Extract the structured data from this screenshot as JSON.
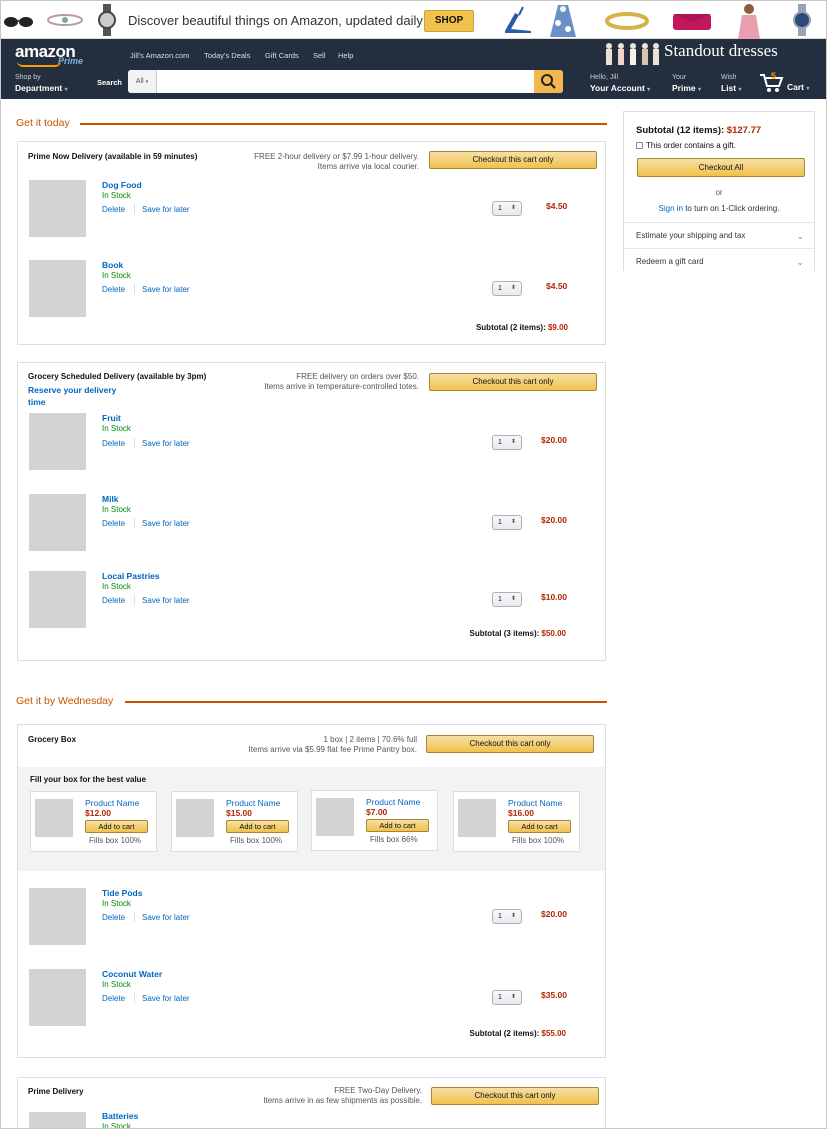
{
  "banner": {
    "text": "Discover beautiful things on Amazon, updated daily",
    "shop": "SHOP"
  },
  "nav": {
    "logo": "amazon",
    "prime": "Prime",
    "top_links": [
      "Jill's Amazon.com",
      "Today's Deals",
      "Gift Cards",
      "Sell",
      "Help"
    ],
    "promo": "Standout dresses",
    "shop_by_small": "Shop by",
    "shop_by_big": "Department",
    "search_label": "Search",
    "search_scope": "All",
    "hello": "Hello, Jill",
    "your_account": "Your Account",
    "your": "Your",
    "prime_link": "Prime",
    "wish": "Wish",
    "list": "List",
    "cart_count": "5",
    "cart": "Cart"
  },
  "section1": {
    "title": "Get it today"
  },
  "section2": {
    "title": "Get it by Wednesday"
  },
  "common": {
    "delete": "Delete",
    "save_for_later": "Save for later",
    "in_stock": "In Stock",
    "checkout_only": "Checkout this cart only",
    "add_to_cart": "Add to cart"
  },
  "prime_now": {
    "title": "Prime Now Delivery (available in 59 minutes)",
    "note1": "FREE 2-hour delivery or $7.99 1-hour delivery.",
    "note2": "Items arrive via local courier.",
    "items": [
      {
        "name": "Dog Food",
        "qty": "1",
        "price": "$4.50"
      },
      {
        "name": "Book",
        "qty": "1",
        "price": "$4.50"
      }
    ],
    "subtotal_label": "Subtotal (2 items):",
    "subtotal": "$9.00"
  },
  "grocery_scheduled": {
    "title": "Grocery Scheduled Delivery (available by 3pm)",
    "reserve1": "Reserve your delivery",
    "reserve2": "time",
    "note1": "FREE delivery on orders over $50.",
    "note2": "Items arrive in temperature-controlled totes.",
    "items": [
      {
        "name": "Fruit",
        "qty": "1",
        "price": "$20.00"
      },
      {
        "name": "Milk",
        "qty": "1",
        "price": "$20.00"
      },
      {
        "name": "Local Pastries",
        "qty": "1",
        "price": "$10.00"
      }
    ],
    "subtotal_label": "Subtotal (3 items):",
    "subtotal": "$50.00"
  },
  "grocery_box": {
    "title": "Grocery Box",
    "note1": "1 box | 2 items | 70.6% full",
    "note2": "Items arrive via $5.99 flat fee Prime Pantry box.",
    "fill_title": "Fill your box for the best value",
    "suggestions": [
      {
        "name": "Product Name",
        "price": "$12.00",
        "fills": "Fills box 100%"
      },
      {
        "name": "Product Name",
        "price": "$15.00",
        "fills": "Fills box 100%"
      },
      {
        "name": "Product Name",
        "price": "$7.00",
        "fills": "Fills box 66%"
      },
      {
        "name": "Product Name",
        "price": "$16.00",
        "fills": "Fills box 100%"
      }
    ],
    "items": [
      {
        "name": "Tide Pods",
        "qty": "1",
        "price": "$20.00"
      },
      {
        "name": "Coconut Water",
        "qty": "1",
        "price": "$35.00"
      }
    ],
    "subtotal_label": "Subtotal (2 items):",
    "subtotal": "$55.00"
  },
  "prime_delivery": {
    "title": "Prime Delivery",
    "note1": "FREE Two-Day Delivery.",
    "note2": "Items arrive in as few shipments as possible.",
    "items": [
      {
        "name": "Batteries"
      }
    ]
  },
  "sidebar": {
    "subtotal_label": "Subtotal (12 items):",
    "subtotal": "$127.77",
    "gift": "This order contains a gift.",
    "checkout_all": "Checkout All",
    "or": "or",
    "sign_in": "Sign in",
    "sign_in_rest": " to turn on 1-Click ordering.",
    "estimate": "Estimate your shipping and tax",
    "redeem": "Redeem a gift card"
  },
  "colors": {
    "nav": "#232f3e",
    "accent": "#c45500",
    "price": "#b12704",
    "link": "#0066c0",
    "button": "#f0c14b"
  }
}
